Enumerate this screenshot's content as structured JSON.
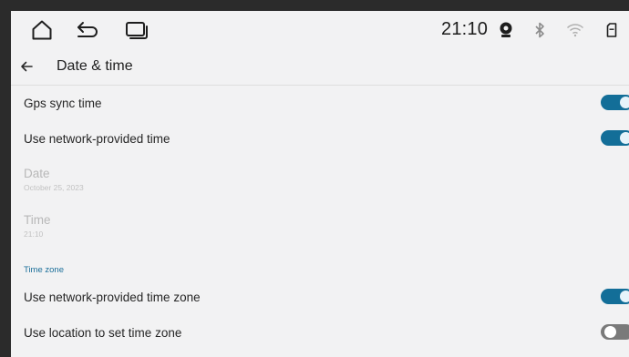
{
  "status_bar": {
    "time": "21:10",
    "icons": [
      "home-icon",
      "back-arrow-icon",
      "recent-apps-icon",
      "camera-icon",
      "bluetooth-icon",
      "wifi-icon",
      "sd-card-icon"
    ]
  },
  "app_bar": {
    "title": "Date & time"
  },
  "settings": {
    "gps_sync": {
      "label": "Gps sync time",
      "enabled": true
    },
    "network_time": {
      "label": "Use network-provided time",
      "enabled": true
    },
    "date": {
      "label": "Date",
      "value": "October 25, 2023"
    },
    "time": {
      "label": "Time",
      "value": "21:10"
    },
    "section_label": "Time zone",
    "network_time_zone": {
      "label": "Use network-provided time zone",
      "enabled": true
    },
    "location_time_zone": {
      "label": "Use location to set time zone",
      "enabled": false
    }
  },
  "colors": {
    "accent": "#136e98",
    "section_text": "#1a6e99",
    "switch_off": "#7a7a7a",
    "background": "#f2f2f3"
  }
}
